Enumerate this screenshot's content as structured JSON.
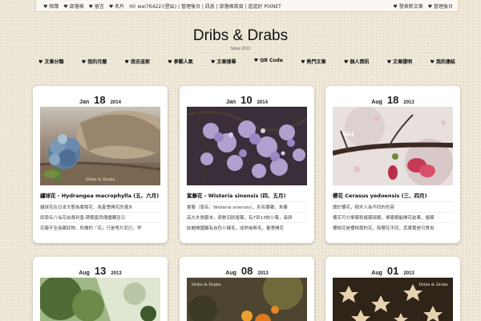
{
  "topbar": {
    "items": [
      "♥ 相簿",
      "♥ 部落格",
      "♥ 留言",
      "♥ 名片"
    ],
    "greeting": "Hi! wei76422!(登出) | 管理後台 | 訊息 | 部落格首頁 | 逛逛好 PIXNET",
    "right": [
      "♥ 發表新文章",
      "♥ 管理後台"
    ]
  },
  "site": {
    "title": "Dribs & Drabs",
    "since": "Since 2013"
  },
  "nav": [
    "♥ 文章分類",
    "♥ 我的月曆",
    "♥ 我去這家",
    "♥ 參觀人氣",
    "♥ 文章搜尋",
    "♥ QR Code",
    "♥ 熱門文章",
    "♥ 個人資訊",
    "♥ 文章證明",
    "♥ 我的連結"
  ],
  "posts": [
    {
      "month": "Jan",
      "day": "18",
      "year": "2014",
      "title": "繡球花 - Hydrangea macrophylla (五、六月)",
      "lines": [
        "繡球花在日本文藝為紫陽花，為夏季開花的灌木",
        "原學名八仙花由貴利香‧蒔蘭夏西傳播轉至日",
        "花瓣不全為瓣狀物，所謂的「花」只是萼片而已，早"
      ],
      "watermark": "Dribs & Drabs"
    },
    {
      "month": "Jan",
      "day": "10",
      "year": "2014",
      "title": "紫藤花 - Wisteria sinensis (四、五月)",
      "lines": [
        "紫藤（學名：Wisteria sinensis），別名藤蘿，朱藤",
        "高大木質藤本，奇數羽狀複葉，有7到13枚小葉，長卵",
        "紡麗開園顯有自色小鍊毛，成熟後無毛，春季開花"
      ],
      "watermark": ""
    },
    {
      "month": "Aug",
      "day": "18",
      "year": "2013",
      "title": "櫻花 Cerasus yedoensis (三、四月)",
      "lines": [
        "關於櫻花，樹木人為不同的形容",
        "櫻花可分單瓣和複瓣兩類，單瓣類能開花結果，複瓣",
        "櫻桃花是櫻桃樹的花，和櫻花不同，其果實是可食用"
      ],
      "watermark": "Wei"
    },
    {
      "month": "Aug",
      "day": "13",
      "year": "2013",
      "title": "",
      "lines": [],
      "watermark": ""
    },
    {
      "month": "Aug",
      "day": "08",
      "year": "2013",
      "title": "",
      "lines": [],
      "watermark": "Dribs & Drabs"
    },
    {
      "month": "Aug",
      "day": "01",
      "year": "2013",
      "title": "",
      "lines": [],
      "watermark": "Dribs & Drabs"
    }
  ]
}
